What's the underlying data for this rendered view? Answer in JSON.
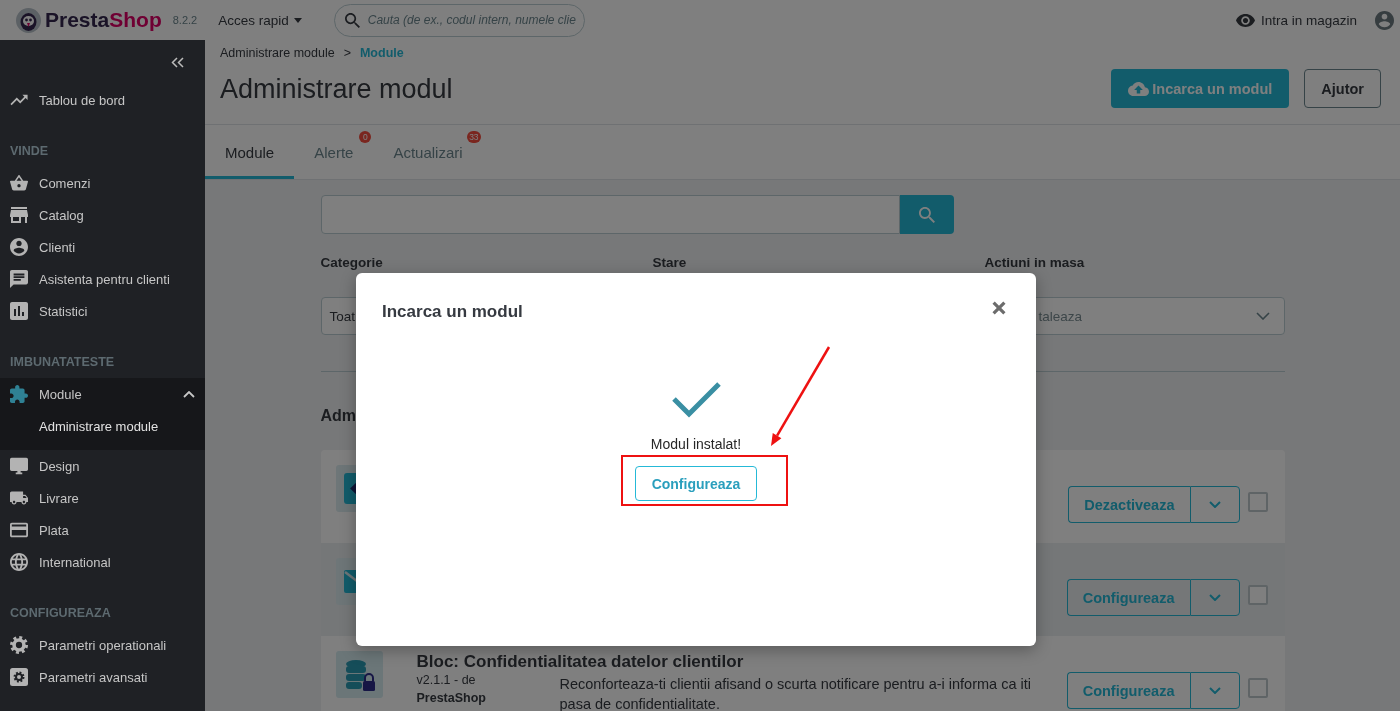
{
  "topbar": {
    "logo": [
      "Presta",
      "Shop"
    ],
    "version": "8.2.2",
    "quick_access": "Acces rapid",
    "search": {
      "placeholder": "Cauta (de ex., codul intern, numele clie"
    },
    "shop_link": "Intra in magazin"
  },
  "sidebar": {
    "groups": [
      {
        "items": [
          {
            "label": "Tablou de bord",
            "selected": false,
            "expanded": false
          }
        ]
      },
      {
        "title": "VINDE",
        "items": [
          {
            "label": "Comenzi",
            "selected": false,
            "expanded": false
          },
          {
            "label": "Catalog",
            "selected": false,
            "expanded": false
          },
          {
            "label": "Clienti",
            "selected": false,
            "expanded": false
          },
          {
            "label": "Asistenta pentru clienti",
            "selected": false,
            "expanded": false
          },
          {
            "label": "Statistici",
            "selected": false,
            "expanded": false
          }
        ]
      },
      {
        "title": "IMBUNATATESTE",
        "items": [
          {
            "label": "Module",
            "selected": true,
            "expanded": true,
            "children": [
              {
                "label": "Administrare module",
                "selected": true
              }
            ]
          },
          {
            "label": "Design",
            "selected": false,
            "expanded": false
          },
          {
            "label": "Livrare",
            "selected": false,
            "expanded": false
          },
          {
            "label": "Plata",
            "selected": false,
            "expanded": false
          },
          {
            "label": "International",
            "selected": false,
            "expanded": false
          }
        ]
      },
      {
        "title": "CONFIGUREAZA",
        "items": [
          {
            "label": "Parametri operationali",
            "selected": false,
            "expanded": false
          },
          {
            "label": "Parametri avansati",
            "selected": false,
            "expanded": false
          }
        ]
      }
    ]
  },
  "breadcrumb": {
    "separator": ">",
    "items": [
      {
        "label": "Administrare module",
        "selected": false
      },
      {
        "label": "Module",
        "selected": true
      }
    ]
  },
  "title": "Administrare modul",
  "toolbar": [
    {
      "label": "Incarca un modul",
      "kind": "primary"
    },
    {
      "label": "Ajutor",
      "kind": "outline"
    }
  ],
  "tabs": [
    {
      "label": "Module",
      "selected": true
    },
    {
      "label": "Alerte",
      "selected": false,
      "badge": "0"
    },
    {
      "label": "Actualizari",
      "selected": false,
      "badge": "33"
    }
  ],
  "filters": [
    {
      "label": "Categorie",
      "value": "Toat"
    },
    {
      "label": "Stare"
    },
    {
      "label": "Actiuni in masa",
      "value": "taleaza"
    }
  ],
  "section_title": "Adm",
  "modules": [
    {
      "action": "Dezactiveaza",
      "checked": false
    },
    {
      "action": "Configureaza",
      "checked": false
    },
    {
      "name": "Bloc: Confidentialitatea datelor clientilor",
      "version": "v2.1.1 - de",
      "author": "PrestaShop",
      "description": "Reconforteaza-ti clientii afisand o scurta notificare pentru a-i informa ca iti pasa de confidentialitate.",
      "action": "Configureaza",
      "checked": false
    }
  ],
  "modal": {
    "title": "Incarca un modul",
    "message": "Modul instalat!",
    "button": "Configureaza"
  }
}
